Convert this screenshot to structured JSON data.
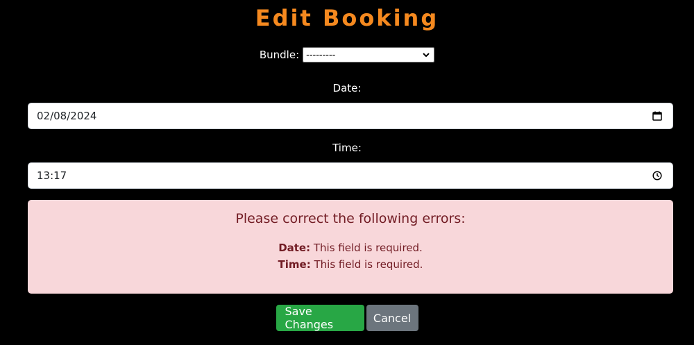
{
  "page": {
    "title": "Edit Booking"
  },
  "form": {
    "bundle": {
      "label": "Bundle:",
      "selected": "---------"
    },
    "date": {
      "label": "Date:",
      "value": "02/08/2024",
      "icon": "calendar-icon"
    },
    "time": {
      "label": "Time:",
      "value": "13:17",
      "icon": "clock-icon"
    }
  },
  "errors": {
    "heading": "Please correct the following errors:",
    "items": [
      {
        "field": "Date:",
        "message": " This field is required."
      },
      {
        "field": "Time:",
        "message": " This field is required."
      }
    ]
  },
  "actions": {
    "save_label": "Save Changes",
    "cancel_label": "Cancel"
  },
  "colors": {
    "title": "#f5891f",
    "alert_bg": "#f8d7da",
    "alert_text": "#721c24",
    "save": "#28a745",
    "cancel": "#6c757d"
  }
}
